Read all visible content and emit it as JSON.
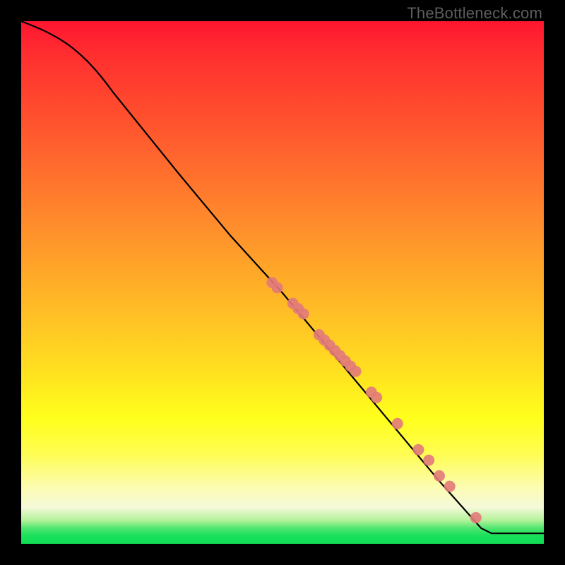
{
  "watermark": "TheBottleneck.com",
  "chart_data": {
    "type": "line",
    "title": "",
    "xlabel": "",
    "ylabel": "",
    "xlim": [
      0,
      100
    ],
    "ylim": [
      0,
      100
    ],
    "curve": [
      {
        "x": 0,
        "y": 100
      },
      {
        "x": 5,
        "y": 98
      },
      {
        "x": 10,
        "y": 95
      },
      {
        "x": 15,
        "y": 90
      },
      {
        "x": 20,
        "y": 83
      },
      {
        "x": 30,
        "y": 71
      },
      {
        "x": 40,
        "y": 59
      },
      {
        "x": 50,
        "y": 48
      },
      {
        "x": 60,
        "y": 36
      },
      {
        "x": 70,
        "y": 24
      },
      {
        "x": 80,
        "y": 12
      },
      {
        "x": 88,
        "y": 3
      },
      {
        "x": 90,
        "y": 2
      },
      {
        "x": 100,
        "y": 2
      }
    ],
    "markers": [
      {
        "x": 48,
        "y": 50
      },
      {
        "x": 49,
        "y": 49
      },
      {
        "x": 52,
        "y": 46
      },
      {
        "x": 53,
        "y": 45
      },
      {
        "x": 54,
        "y": 44
      },
      {
        "x": 57,
        "y": 40
      },
      {
        "x": 58,
        "y": 39
      },
      {
        "x": 59,
        "y": 38
      },
      {
        "x": 60,
        "y": 37
      },
      {
        "x": 61,
        "y": 36
      },
      {
        "x": 62,
        "y": 35
      },
      {
        "x": 63,
        "y": 34
      },
      {
        "x": 64,
        "y": 33
      },
      {
        "x": 67,
        "y": 29
      },
      {
        "x": 68,
        "y": 28
      },
      {
        "x": 72,
        "y": 23
      },
      {
        "x": 76,
        "y": 18
      },
      {
        "x": 78,
        "y": 16
      },
      {
        "x": 80,
        "y": 13
      },
      {
        "x": 82,
        "y": 11
      },
      {
        "x": 87,
        "y": 5
      }
    ],
    "marker_color": "#e27a7a",
    "curve_color": "#000000"
  }
}
